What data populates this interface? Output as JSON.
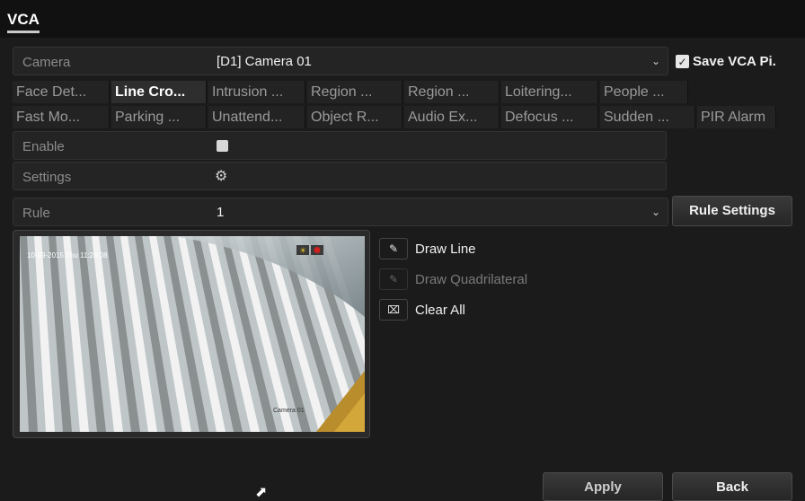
{
  "header": {
    "tab_label": "VCA"
  },
  "camera": {
    "label": "Camera",
    "value": "[D1] Camera 01",
    "save_label": "Save VCA Pi.",
    "save_checked": true
  },
  "vca_types_row1": [
    "Face Det...",
    "Line Cro...",
    "Intrusion ...",
    "Region ...",
    "Region ...",
    "Loitering...",
    "People ..."
  ],
  "vca_types_row2": [
    "Fast Mo...",
    "Parking ...",
    "Unattend...",
    "Object R...",
    "Audio Ex...",
    "Defocus ...",
    "Sudden ...",
    "PIR Alarm"
  ],
  "active_type": "Line Cro...",
  "enable": {
    "label": "Enable"
  },
  "settings": {
    "label": "Settings"
  },
  "rule": {
    "label": "Rule",
    "value": "1",
    "button": "Rule Settings"
  },
  "preview": {
    "timestamp": "10-29-2015 Thu 11:28:08",
    "camera_caption": "Camera 01"
  },
  "tools": {
    "draw_line": "Draw Line",
    "draw_quad": "Draw Quadrilateral",
    "clear_all": "Clear All"
  },
  "footer": {
    "apply": "Apply",
    "back": "Back"
  },
  "colors": {
    "background": "#1b1b1b",
    "accent": "#c9c9c9"
  }
}
